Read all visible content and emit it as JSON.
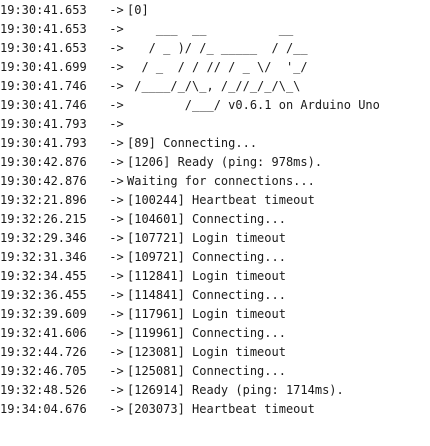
{
  "serial_monitor": {
    "separator": " ->",
    "lines": [
      {
        "timestamp": "19:30:41.653",
        "message": "[0]"
      },
      {
        "timestamp": "19:30:41.653",
        "message": "    ___  __          __"
      },
      {
        "timestamp": "19:30:41.653",
        "message": "   / _ )/ /_ _____  / /__"
      },
      {
        "timestamp": "19:30:41.699",
        "message": "  / _  / / // / _ \\/  '_/"
      },
      {
        "timestamp": "19:30:41.746",
        "message": " /____/_/\\_, /_//_/_/\\_\\"
      },
      {
        "timestamp": "19:30:41.746",
        "message": "        /___/ v0.6.1 on Arduino Uno"
      },
      {
        "timestamp": "19:30:41.793",
        "message": ""
      },
      {
        "timestamp": "19:30:41.793",
        "message": "[89] Connecting..."
      },
      {
        "timestamp": "19:30:42.876",
        "message": "[1206] Ready (ping: 978ms)."
      },
      {
        "timestamp": "19:30:42.876",
        "message": "Waiting for connections..."
      },
      {
        "timestamp": "19:32:21.896",
        "message": "[100244] Heartbeat timeout"
      },
      {
        "timestamp": "19:32:26.215",
        "message": "[104601] Connecting..."
      },
      {
        "timestamp": "19:32:29.346",
        "message": "[107721] Login timeout"
      },
      {
        "timestamp": "19:32:31.346",
        "message": "[109721] Connecting..."
      },
      {
        "timestamp": "19:32:34.455",
        "message": "[112841] Login timeout"
      },
      {
        "timestamp": "19:32:36.455",
        "message": "[114841] Connecting..."
      },
      {
        "timestamp": "19:32:39.609",
        "message": "[117961] Login timeout"
      },
      {
        "timestamp": "19:32:41.606",
        "message": "[119961] Connecting..."
      },
      {
        "timestamp": "19:32:44.726",
        "message": "[123081] Login timeout"
      },
      {
        "timestamp": "19:32:46.705",
        "message": "[125081] Connecting..."
      },
      {
        "timestamp": "19:32:48.526",
        "message": "[126914] Ready (ping: 1714ms)."
      },
      {
        "timestamp": "19:34:04.676",
        "message": "[203073] Heartbeat timeout"
      }
    ]
  }
}
